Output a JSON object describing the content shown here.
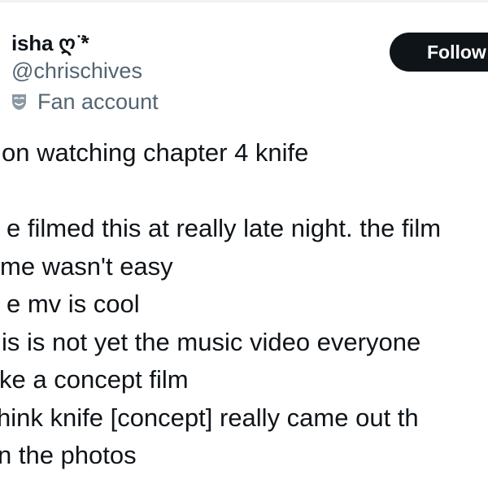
{
  "author": {
    "display_name": "isha ღ ̈*",
    "handle": "@chrischives",
    "label": "Fan account",
    "label_icon": "theater-masks-icon"
  },
  "actions": {
    "follow_label": "Follow"
  },
  "tweet": {
    "lines": [
      "on watching chapter 4 knife",
      "",
      "e filmed this at really late night. the film",
      "me wasn't easy",
      "e mv is cool",
      "is is not yet the music video everyone",
      "ke a concept film",
      "hink knife [concept] really came out th",
      "n the photos"
    ]
  },
  "colors": {
    "text_primary": "#0f1419",
    "text_secondary": "#536471",
    "button_bg": "#0f1419",
    "button_text": "#ffffff",
    "border": "#eff3f4"
  }
}
